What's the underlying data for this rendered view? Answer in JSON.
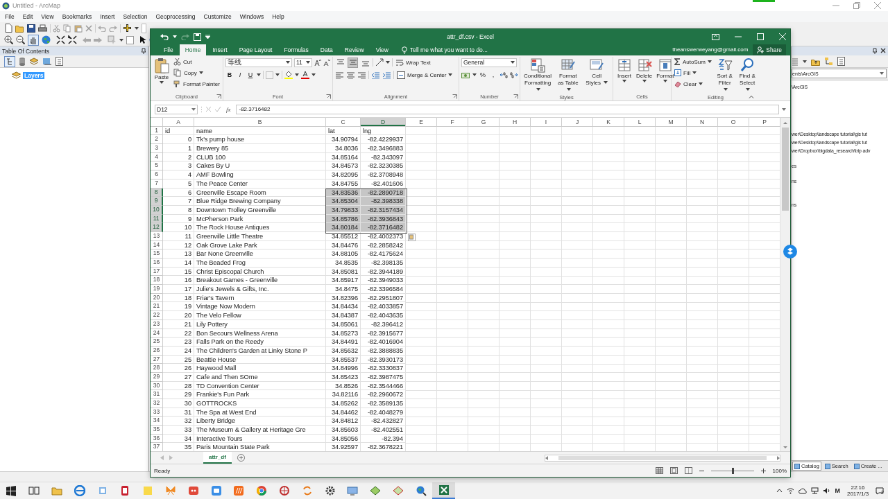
{
  "arcmap": {
    "title": "Untitled - ArcMap",
    "menu": [
      "File",
      "Edit",
      "View",
      "Bookmarks",
      "Insert",
      "Selection",
      "Geoprocessing",
      "Customize",
      "Windows",
      "Help"
    ],
    "toc": {
      "title": "Table Of Contents",
      "layers": [
        {
          "label": "Layers",
          "selected": true
        }
      ]
    },
    "catalog": {
      "location": "ents\\ArcGIS",
      "items": [
        "\\ArcGIS",
        "wer\\Desktop\\landscape  tutorial\\gis tut",
        "wer\\Desktop\\landscape  tutorial\\gis tut",
        "wer\\Dropbox\\bigdata_research\\trip adv",
        "es",
        "ns",
        "ns"
      ],
      "tabs": [
        {
          "label": "Catalog",
          "selected": true
        },
        {
          "label": "Search",
          "selected": false
        },
        {
          "label": "Create ...",
          "selected": false
        }
      ]
    }
  },
  "excel": {
    "title": "attr_df.csv - Excel",
    "tabs": [
      {
        "label": "File",
        "selected": false
      },
      {
        "label": "Home",
        "selected": true
      },
      {
        "label": "Insert",
        "selected": false
      },
      {
        "label": "Page Layout",
        "selected": false
      },
      {
        "label": "Formulas",
        "selected": false
      },
      {
        "label": "Data",
        "selected": false
      },
      {
        "label": "Review",
        "selected": false
      },
      {
        "label": "View",
        "selected": false
      }
    ],
    "tell_me": "Tell me what you want to do...",
    "account": "theanswerweyang@gmail.com",
    "share": "Share",
    "ribbon": {
      "clipboard": {
        "label": "Clipboard",
        "paste": "Paste",
        "items": [
          "Cut",
          "Copy",
          "Format Painter"
        ]
      },
      "font": {
        "label": "Font",
        "font_name": "等线",
        "font_size": "11",
        "styles": [
          "B",
          "I",
          "U"
        ]
      },
      "alignment": {
        "label": "Alignment",
        "wrap_text": "Wrap Text",
        "merge": "Merge & Center",
        "vertical_align": [
          {
            "kind": "top",
            "selected": false
          },
          {
            "kind": "middle",
            "selected": true
          },
          {
            "kind": "bottom",
            "selected": false
          }
        ]
      },
      "number": {
        "label": "Number",
        "format": "General",
        "symbols": [
          "%",
          ","
        ]
      },
      "styles": {
        "label": "Styles",
        "buttons": [
          "Conditional Formatting",
          "Format as Table",
          "Cell Styles"
        ]
      },
      "cells": {
        "label": "Cells",
        "buttons": [
          "Insert",
          "Delete",
          "Format"
        ]
      },
      "editing": {
        "label": "Editing",
        "items": [
          "AutoSum",
          "Fill",
          "Clear"
        ],
        "buttons": [
          "Sort & Filter",
          "Find & Select"
        ]
      }
    },
    "name_box": "D12",
    "function_button": "fx",
    "formula": "-82.3716482",
    "columns": [
      {
        "label": "A",
        "selected": false
      },
      {
        "label": "B",
        "selected": false
      },
      {
        "label": "C",
        "selected": false
      },
      {
        "label": "D",
        "selected": true
      },
      {
        "label": "E",
        "selected": false
      },
      {
        "label": "F",
        "selected": false
      },
      {
        "label": "G",
        "selected": false
      },
      {
        "label": "H",
        "selected": false
      },
      {
        "label": "I",
        "selected": false
      },
      {
        "label": "J",
        "selected": false
      },
      {
        "label": "K",
        "selected": false
      },
      {
        "label": "L",
        "selected": false
      },
      {
        "label": "M",
        "selected": false
      },
      {
        "label": "N",
        "selected": false
      },
      {
        "label": "O",
        "selected": false
      },
      {
        "label": "P",
        "selected": false
      }
    ],
    "rows": [
      {
        "number": "1",
        "kind": "header",
        "cells": [
          "id",
          "name",
          "lat",
          "lng"
        ],
        "selected": false
      },
      {
        "number": "2",
        "kind": "data",
        "cells": [
          "0",
          "Tk's pump house",
          "34.90794",
          "-82.4229937"
        ],
        "selected": false
      },
      {
        "number": "3",
        "kind": "data",
        "cells": [
          "1",
          "Brewery 85",
          "34.8036",
          "-82.3496883"
        ],
        "selected": false
      },
      {
        "number": "4",
        "kind": "data",
        "cells": [
          "2",
          "CLUB 100",
          "34.85164",
          "-82.343097"
        ],
        "selected": false
      },
      {
        "number": "5",
        "kind": "data",
        "cells": [
          "3",
          "Cakes By U",
          "34.84573",
          "-82.3230385"
        ],
        "selected": false
      },
      {
        "number": "6",
        "kind": "data",
        "cells": [
          "4",
          "AMF Bowling",
          "34.82095",
          "-82.3708948"
        ],
        "selected": false
      },
      {
        "number": "7",
        "kind": "data",
        "cells": [
          "5",
          "The Peace Center",
          "34.84755",
          "-82.401606"
        ],
        "selected": false
      },
      {
        "number": "8",
        "kind": "data",
        "cells": [
          "6",
          "Greenville Escape Room",
          "34.83536",
          "-82.2890718"
        ],
        "selected": true
      },
      {
        "number": "9",
        "kind": "data",
        "cells": [
          "7",
          "Blue Ridge Brewing Company",
          "34.85304",
          "-82.398338"
        ],
        "selected": true
      },
      {
        "number": "10",
        "kind": "data",
        "cells": [
          "8",
          "Downtown Trolley Greenville",
          "34.79833",
          "-82.3157434"
        ],
        "selected": true
      },
      {
        "number": "11",
        "kind": "data",
        "cells": [
          "9",
          "McPherson Park",
          "34.85786",
          "-82.3936843"
        ],
        "selected": true
      },
      {
        "number": "12",
        "kind": "data",
        "cells": [
          "10",
          "The Rock House Antiques",
          "34.80184",
          "-82.3716482"
        ],
        "selected": true
      },
      {
        "number": "13",
        "kind": "data",
        "cells": [
          "11",
          "Greenville Little Theatre",
          "34.85512",
          "-82.4002373"
        ],
        "selected": false
      },
      {
        "number": "14",
        "kind": "data",
        "cells": [
          "12",
          "Oak Grove Lake Park",
          "34.84476",
          "-82.2858242"
        ],
        "selected": false
      },
      {
        "number": "15",
        "kind": "data",
        "cells": [
          "13",
          "Bar None Greenville",
          "34.88105",
          "-82.4175624"
        ],
        "selected": false
      },
      {
        "number": "16",
        "kind": "data",
        "cells": [
          "14",
          "The Beaded Frog",
          "34.8535",
          "-82.398135"
        ],
        "selected": false
      },
      {
        "number": "17",
        "kind": "data",
        "cells": [
          "15",
          "Christ Episcopal Church",
          "34.85081",
          "-82.3944189"
        ],
        "selected": false
      },
      {
        "number": "18",
        "kind": "data",
        "cells": [
          "16",
          "Breakout Games - Greenville",
          "34.85917",
          "-82.3949033"
        ],
        "selected": false
      },
      {
        "number": "19",
        "kind": "data",
        "cells": [
          "17",
          "Julie's Jewels & Gifts, Inc.",
          "34.8475",
          "-82.3396584"
        ],
        "selected": false
      },
      {
        "number": "20",
        "kind": "data",
        "cells": [
          "18",
          "Friar's Tavern",
          "34.82396",
          "-82.2951807"
        ],
        "selected": false
      },
      {
        "number": "21",
        "kind": "data",
        "cells": [
          "19",
          "Vintage Now Modern",
          "34.84434",
          "-82.4033857"
        ],
        "selected": false
      },
      {
        "number": "22",
        "kind": "data",
        "cells": [
          "20",
          "The Velo Fellow",
          "34.84387",
          "-82.4043635"
        ],
        "selected": false
      },
      {
        "number": "23",
        "kind": "data",
        "cells": [
          "21",
          "Lily Pottery",
          "34.85061",
          "-82.396412"
        ],
        "selected": false
      },
      {
        "number": "24",
        "kind": "data",
        "cells": [
          "22",
          "Bon Secours Wellness Arena",
          "34.85273",
          "-82.3915677"
        ],
        "selected": false
      },
      {
        "number": "25",
        "kind": "data",
        "cells": [
          "23",
          "Falls Park on the Reedy",
          "34.84491",
          "-82.4016904"
        ],
        "selected": false
      },
      {
        "number": "26",
        "kind": "data",
        "cells": [
          "24",
          "The Children's Garden at Linky Stone P",
          "34.85632",
          "-82.3888835"
        ],
        "selected": false
      },
      {
        "number": "27",
        "kind": "data",
        "cells": [
          "25",
          "Beattie House",
          "34.85537",
          "-82.3930173"
        ],
        "selected": false
      },
      {
        "number": "28",
        "kind": "data",
        "cells": [
          "26",
          "Haywood Mall",
          "34.84996",
          "-82.3330837"
        ],
        "selected": false
      },
      {
        "number": "29",
        "kind": "data",
        "cells": [
          "27",
          "Cafe and Then SOme",
          "34.85423",
          "-82.3987475"
        ],
        "selected": false
      },
      {
        "number": "30",
        "kind": "data",
        "cells": [
          "28",
          "TD Convention Center",
          "34.8526",
          "-82.3544466"
        ],
        "selected": false
      },
      {
        "number": "31",
        "kind": "data",
        "cells": [
          "29",
          "Frankie's Fun Park",
          "34.82116",
          "-82.2960672"
        ],
        "selected": false
      },
      {
        "number": "32",
        "kind": "data",
        "cells": [
          "30",
          "GOTTROCKS",
          "34.85262",
          "-82.3589135"
        ],
        "selected": false
      },
      {
        "number": "33",
        "kind": "data",
        "cells": [
          "31",
          "The Spa at West End",
          "34.84462",
          "-82.4048279"
        ],
        "selected": false
      },
      {
        "number": "34",
        "kind": "data",
        "cells": [
          "32",
          "Liberty Bridge",
          "34.84812",
          "-82.432827"
        ],
        "selected": false
      },
      {
        "number": "35",
        "kind": "data",
        "cells": [
          "33",
          "The Museum & Gallery at Heritage Gre",
          "34.85603",
          "-82.402551"
        ],
        "selected": false
      },
      {
        "number": "36",
        "kind": "data",
        "cells": [
          "34",
          "Interactive Tours",
          "34.85056",
          "-82.394"
        ],
        "selected": false
      },
      {
        "number": "37",
        "kind": "data",
        "cells": [
          "35",
          "Paris Mountain State Park",
          "34.92597",
          "-82.3678221"
        ],
        "selected": false
      }
    ],
    "sheet_tabs": [
      {
        "label": "attr_df",
        "selected": true
      }
    ],
    "status_bar": {
      "status": "Ready",
      "zoom": {
        "level": 0.5,
        "reading": "100%"
      }
    }
  },
  "taskbar": {
    "ime": "M",
    "time": "22:16",
    "date": "2017/1/3",
    "notification_count": "2"
  }
}
